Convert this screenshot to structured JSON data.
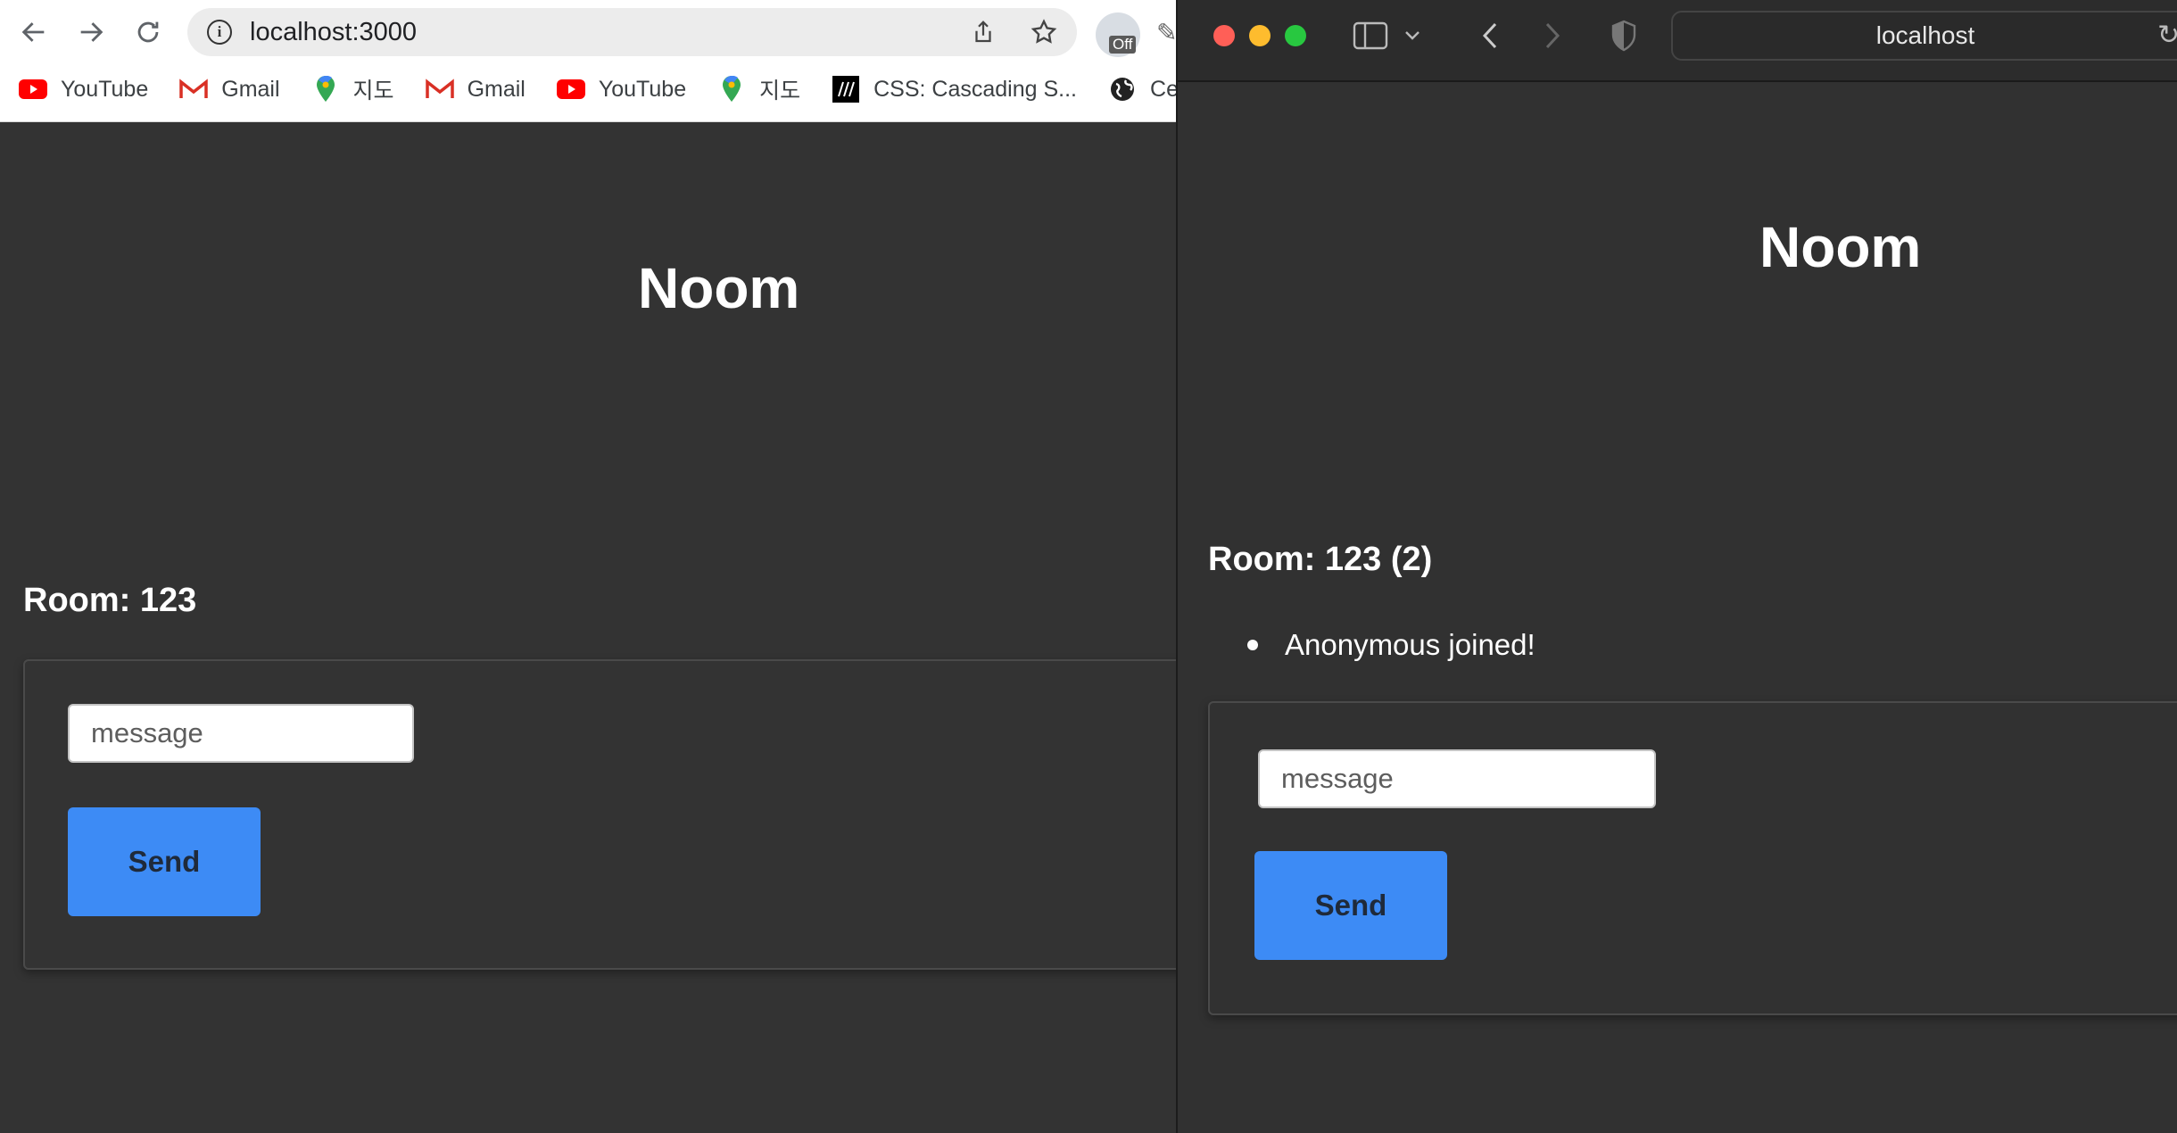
{
  "chrome": {
    "url": "localhost:3000",
    "extension_badge": "Off",
    "bookmarks": [
      {
        "label": "YouTube",
        "icon": "youtube-icon"
      },
      {
        "label": "Gmail",
        "icon": "gmail-icon"
      },
      {
        "label": "지도",
        "icon": "maps-pin-icon"
      },
      {
        "label": "Gmail",
        "icon": "gmail-icon"
      },
      {
        "label": "YouTube",
        "icon": "youtube-icon"
      },
      {
        "label": "지도",
        "icon": "maps-pin-icon"
      },
      {
        "label": "CSS: Cascading S...",
        "icon": "mdn-icon"
      },
      {
        "label": "Ceas",
        "icon": "globe-icon"
      }
    ],
    "page": {
      "title": "Noom",
      "room": "Room: 123",
      "input_placeholder": "message",
      "send_label": "Send"
    }
  },
  "safari": {
    "url": "localhost",
    "page": {
      "title": "Noom",
      "room": "Room: 123 (2)",
      "messages": [
        "Anonymous joined!"
      ],
      "input_placeholder": "message",
      "send_label": "Send"
    }
  },
  "colors": {
    "page_bg": "#333333",
    "send_button": "#3d8bf5",
    "youtube": "#ff0000",
    "traffic_red": "#ff5f57",
    "traffic_yellow": "#febc2e",
    "traffic_green": "#28c840"
  }
}
